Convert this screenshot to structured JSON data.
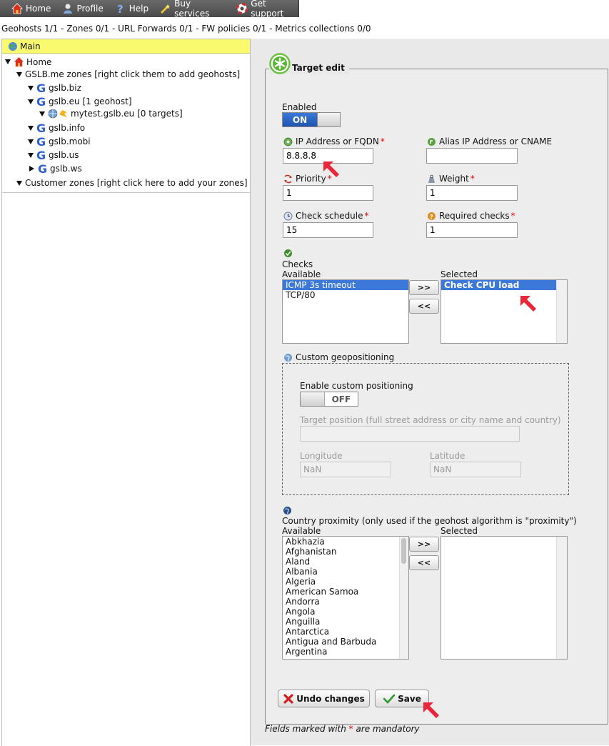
{
  "menu": {
    "home": "Home",
    "profile": "Profile",
    "help": "Help",
    "buy_services": "Buy services",
    "get_support": "Get support"
  },
  "status_line": "Geohosts 1/1 - Zones 0/1 - URL Forwards 0/1 - FW policies 0/1 - Metrics collections 0/0",
  "tree": {
    "header": "Main",
    "home": "Home",
    "gslb_zones": "GSLB.me zones [right click them to add geohosts]",
    "zones": {
      "biz": "gslb.biz",
      "eu": "gslb.eu [1 geohost]",
      "geohost": "mytest.gslb.eu [0 targets]",
      "info": "gslb.info",
      "mobi": "gslb.mobi",
      "us": "gslb.us",
      "ws": "gslb.ws"
    },
    "customer_zones": "Customer zones [right click here to add your zones]"
  },
  "form": {
    "title": "Target edit",
    "enabled_label": "Enabled",
    "enabled_toggle": "ON",
    "ip_label": "IP Address or FQDN",
    "ip_value": "8.8.8.8",
    "alias_label": "Alias IP Address or CNAME",
    "alias_value": "",
    "priority_label": "Priority",
    "priority_value": "1",
    "weight_label": "Weight",
    "weight_value": "1",
    "schedule_label": "Check schedule",
    "schedule_value": "15",
    "required_label": "Required checks",
    "required_value": "1",
    "required_mark": "*",
    "checks_label": "Checks",
    "available_label": "Available",
    "selected_label": "Selected",
    "checks_available": [
      "ICMP 3s timeout",
      "TCP/80"
    ],
    "checks_selected": [
      "Check CPU load"
    ],
    "add_button": ">>",
    "remove_button": "<<",
    "geo_label": "Custom geopositioning",
    "geo_enable_label": "Enable custom positioning",
    "geo_toggle": "OFF",
    "target_position_label": "Target position (full street address or city name and country)",
    "target_position_value": "",
    "longitude_label": "Longitude",
    "longitude_value": "NaN",
    "latitude_label": "Latitude",
    "latitude_value": "NaN",
    "proximity_label": "Country proximity (only used if the geohost algorithm is \"proximity\")",
    "countries_available": [
      "Abkhazia",
      "Afghanistan",
      "Aland",
      "Albania",
      "Algeria",
      "American Samoa",
      "Andorra",
      "Angola",
      "Anguilla",
      "Antarctica",
      "Antigua and Barbuda",
      "Argentina"
    ],
    "countries_selected": [],
    "undo_button": "Undo changes",
    "save_button": "Save",
    "footnote_prefix": "Fields marked with ",
    "footnote_suffix": " are mandatory"
  },
  "colors": {
    "menubar": "#4a4a4a",
    "tree_header": "#fafa6e",
    "selection": "#3b78d8",
    "required": "#dd0000",
    "annotation_arrow": "#e8283a"
  }
}
